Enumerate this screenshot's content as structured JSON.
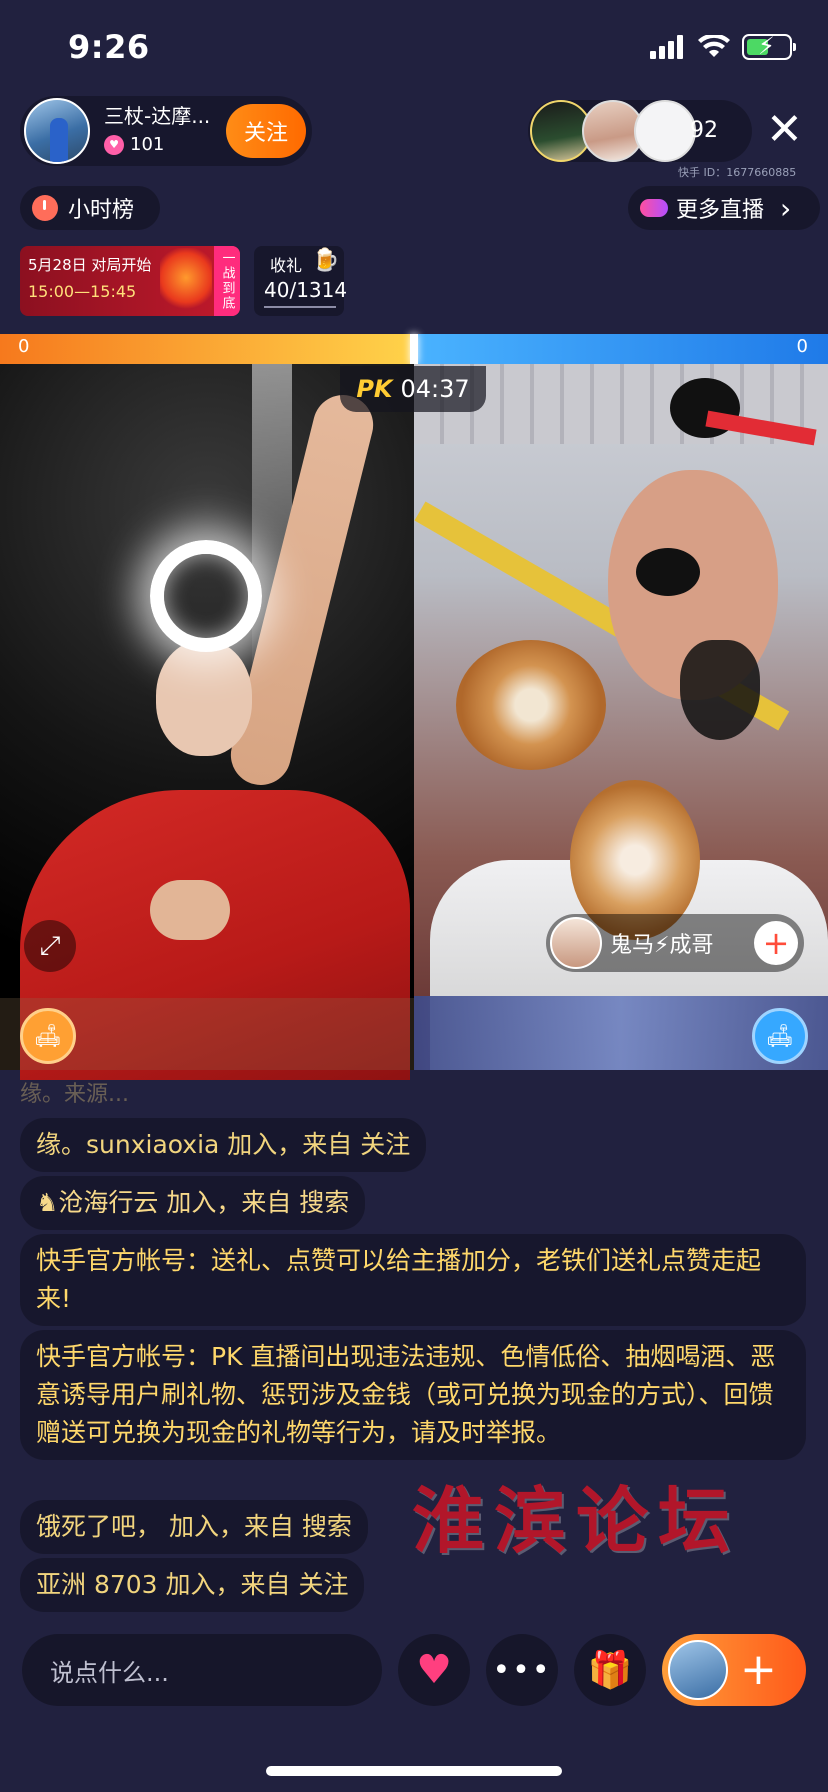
{
  "status_bar": {
    "time": "9:26"
  },
  "host": {
    "name": "三杖-达摩...",
    "likes": "101",
    "follow_label": "关注"
  },
  "viewers": {
    "count": "92",
    "close": "✕",
    "id_text": "快手 ID：1677660885"
  },
  "pills": {
    "rank_label": "小时榜",
    "more_live_label": "更多直播",
    "more_live_chevron": "›"
  },
  "event": {
    "date_text": "5月28日 对局开始",
    "time_text": "15:00—15:45",
    "side_text": "一战到底"
  },
  "gift_goal": {
    "label": "收礼",
    "value": "40/1314"
  },
  "pk": {
    "score_left": "0",
    "score_right": "0",
    "logo": "PK",
    "timer": "04:37"
  },
  "opponent": {
    "name": "鬼马⚡成哥",
    "add": "+"
  },
  "chat": {
    "faded": "缘。来源...",
    "messages": [
      {
        "text": "缘。sunxiaoxia 加入，来自 关注"
      },
      {
        "text": "♞沧海行云 加入，来自 搜索"
      },
      {
        "text": "快手官方帐号：送礼、点赞可以给主播加分，老铁们送礼点赞走起来!"
      },
      {
        "text": "快手官方帐号：PK 直播间出现违法违规、色情低俗、抽烟喝酒、恶意诱导用户刷礼物、惩罚涉及金钱（或可兑换为现金的方式）、回馈赠送可兑换为现金的礼物等行为，请及时举报。"
      },
      {
        "text": "饿死了吧， 加入，来自 搜索"
      },
      {
        "text": "亚洲 8703 加入，来自 关注"
      }
    ]
  },
  "watermark": "淮滨论坛",
  "bottom": {
    "input_placeholder": "说点什么...",
    "more": "•••",
    "share_plus": "+"
  },
  "colors": {
    "accent_orange": "#ff7a00",
    "accent_blue": "#1f7ae8",
    "chat_text": "#f2d57e",
    "bg": "#21213f"
  },
  "icons": [
    "signal-icon",
    "wifi-icon",
    "battery-icon",
    "heart-icon",
    "close-icon",
    "clock-icon",
    "chevron-right-icon",
    "expand-icon",
    "seat-icon",
    "like-heart-icon",
    "gift-icon",
    "plus-icon"
  ]
}
